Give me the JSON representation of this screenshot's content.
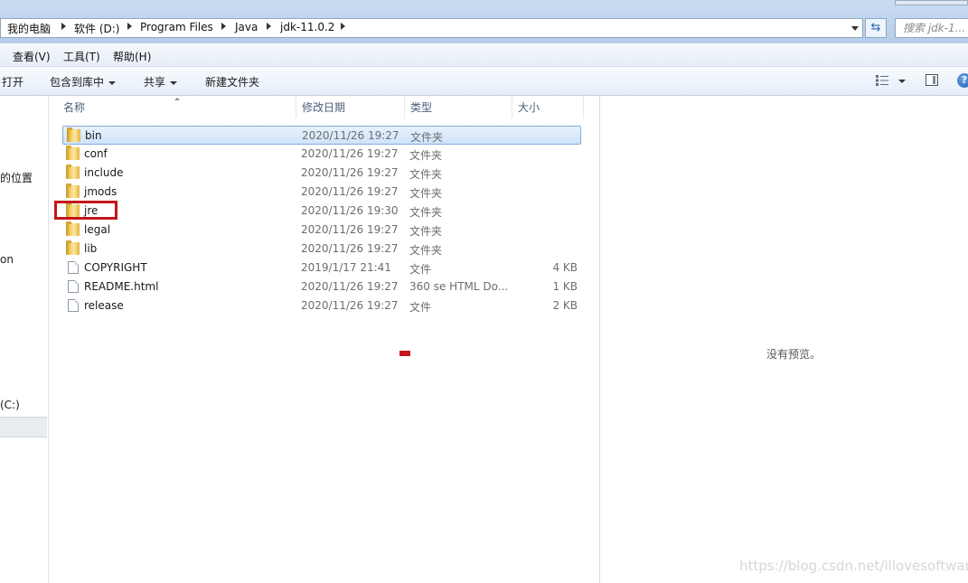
{
  "address": {
    "breadcrumbs": [
      "我的电脑",
      "软件 (D:)",
      "Program Files",
      "Java",
      "jdk-11.0.2"
    ],
    "search_placeholder": "搜索 jdk-1..."
  },
  "menu": {
    "view": "查看(V)",
    "tools": "工具(T)",
    "help": "帮助(H)"
  },
  "toolbar": {
    "open": "打开",
    "include_library": "包含到库中",
    "share": "共享",
    "new_folder": "新建文件夹"
  },
  "nav": {
    "item_location": "的位置",
    "item_on": "on",
    "item_drive_c": "(C:)"
  },
  "columns": {
    "name": "名称",
    "date": "修改日期",
    "type": "类型",
    "size": "大小"
  },
  "files": [
    {
      "name": "bin",
      "date": "2020/11/26 19:27",
      "type": "文件夹",
      "size": "",
      "kind": "folder"
    },
    {
      "name": "conf",
      "date": "2020/11/26 19:27",
      "type": "文件夹",
      "size": "",
      "kind": "folder"
    },
    {
      "name": "include",
      "date": "2020/11/26 19:27",
      "type": "文件夹",
      "size": "",
      "kind": "folder"
    },
    {
      "name": "jmods",
      "date": "2020/11/26 19:27",
      "type": "文件夹",
      "size": "",
      "kind": "folder"
    },
    {
      "name": "jre",
      "date": "2020/11/26 19:30",
      "type": "文件夹",
      "size": "",
      "kind": "folder"
    },
    {
      "name": "legal",
      "date": "2020/11/26 19:27",
      "type": "文件夹",
      "size": "",
      "kind": "folder"
    },
    {
      "name": "lib",
      "date": "2020/11/26 19:27",
      "type": "文件夹",
      "size": "",
      "kind": "folder"
    },
    {
      "name": "COPYRIGHT",
      "date": "2019/1/17 21:41",
      "type": "文件",
      "size": "4 KB",
      "kind": "file"
    },
    {
      "name": "README.html",
      "date": "2020/11/26 19:27",
      "type": "360 se HTML Do...",
      "size": "1 KB",
      "kind": "file"
    },
    {
      "name": "release",
      "date": "2020/11/26 19:27",
      "type": "文件",
      "size": "2 KB",
      "kind": "file"
    }
  ],
  "preview": {
    "empty_text": "没有预览。"
  },
  "watermark": "https://blog.csdn.net/illovesoftware",
  "colors": {
    "highlight": "#c4161c",
    "selection_border": "#84acdd"
  }
}
